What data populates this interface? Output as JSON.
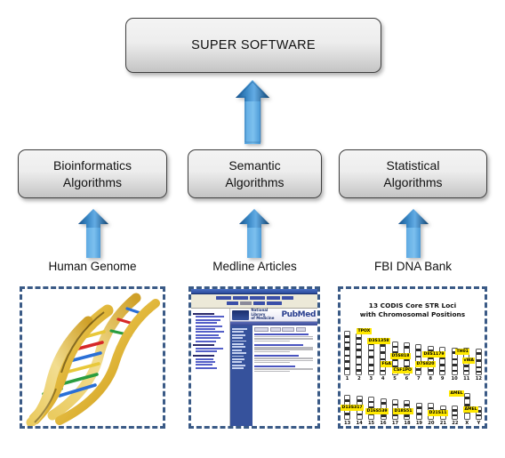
{
  "diagram": {
    "top_box": {
      "label": "SUPER SOFTWARE"
    },
    "algorithm_boxes": [
      {
        "name": "bioinformatics",
        "line1": "Bioinformatics",
        "line2": "Algorithms"
      },
      {
        "name": "semantic",
        "line1": "Semantic",
        "line2": "Algorithms"
      },
      {
        "name": "statistical",
        "line1": "Statistical",
        "line2": "Algorithms"
      }
    ],
    "source_captions": [
      {
        "name": "human-genome",
        "label": "Human Genome"
      },
      {
        "name": "medline-articles",
        "label": "Medline Articles"
      },
      {
        "name": "fbi-dna-bank",
        "label": "FBI DNA Bank"
      }
    ],
    "arrow_icon": "up-arrow-icon",
    "colors": {
      "arrow_light": "#6cb0e8",
      "arrow_mid": "#3d8fd1",
      "arrow_dark": "#1f5f9e",
      "box_border": "#3f3f3f",
      "box_fill_top": "#f4f4f4",
      "box_fill_bottom": "#c4c4c4",
      "panel_dash": "#3a5a86",
      "locus_highlight": "#ffe800",
      "dna_backbone": "#e0b93a"
    }
  },
  "panels": {
    "dna": {
      "name": "dna-double-helix-image",
      "alt": "DNA double helix illustration",
      "rung_colors": [
        "#d62828",
        "#2a9d3f",
        "#2a6fd6",
        "#e8c83a",
        "#111111"
      ]
    },
    "pubmed": {
      "name": "pubmed-screenshot-image",
      "alt": "PubMed search results web page screenshot",
      "nlm_line1": "National Library",
      "nlm_line2": "of Medicine",
      "wordmark": "PubMed"
    },
    "codis": {
      "name": "codis-str-loci-image",
      "title_line1": "13 CODIS Core STR Loci",
      "title_line2": "with Chromosomal Positions",
      "row1_numbers": [
        "1",
        "2",
        "3",
        "4",
        "5",
        "6",
        "7",
        "8",
        "9",
        "10",
        "11",
        "12"
      ],
      "row2_numbers": [
        "13",
        "14",
        "15",
        "16",
        "17",
        "18",
        "19",
        "20",
        "21",
        "22",
        "X",
        "Y"
      ],
      "loci": [
        {
          "label": "TPOX",
          "chromosome": "2"
        },
        {
          "label": "D3S1358",
          "chromosome": "3"
        },
        {
          "label": "FGA",
          "chromosome": "4"
        },
        {
          "label": "D5S818",
          "chromosome": "5"
        },
        {
          "label": "CSF1PO",
          "chromosome": "5"
        },
        {
          "label": "D7S820",
          "chromosome": "7"
        },
        {
          "label": "D8S1179",
          "chromosome": "8"
        },
        {
          "label": "TH01",
          "chromosome": "11"
        },
        {
          "label": "vWA",
          "chromosome": "12"
        },
        {
          "label": "D13S317",
          "chromosome": "13"
        },
        {
          "label": "D16S539",
          "chromosome": "16"
        },
        {
          "label": "D18S51",
          "chromosome": "18"
        },
        {
          "label": "D21S11",
          "chromosome": "21"
        },
        {
          "label": "AMEL",
          "chromosome": "X"
        },
        {
          "label": "AMEL",
          "chromosome": "Y"
        }
      ]
    }
  }
}
